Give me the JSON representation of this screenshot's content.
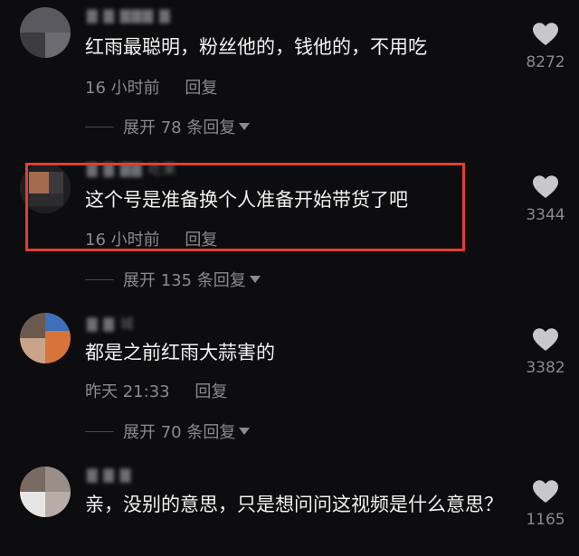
{
  "comments": [
    {
      "username": "▇ ▇ ▇▇▇ ▇",
      "text": "红雨最聪明，粉丝他的，钱他的，不用吃",
      "time": "16 小时前",
      "reply": "回复",
      "expand": "展开 78 条回复",
      "likes": "8272"
    },
    {
      "username": "▇ ▇ ▇▇ 吃果",
      "text": "这个号是准备换个人准备开始带货了吧",
      "time": "16 小时前",
      "reply": "回复",
      "expand": "展开 135 条回复",
      "likes": "3344"
    },
    {
      "username": "▇ ▇ 城",
      "text": "都是之前红雨大蒜害的",
      "time": "昨天 21:33",
      "reply": "回复",
      "expand": "展开 70 条回复",
      "likes": "3382"
    },
    {
      "username": "▇ ▇ ▇",
      "text": "亲，没别的意思，只是想问问这视频是什么意思？",
      "likes": "1165"
    }
  ],
  "colors": {
    "background": "#0d0d0f",
    "highlight": "#e33d35",
    "secondary_text": "#8a8a8e",
    "like_icon": "#c8c8cc"
  },
  "icons": {
    "like": "heart-icon",
    "expand": "caret-down-icon"
  }
}
